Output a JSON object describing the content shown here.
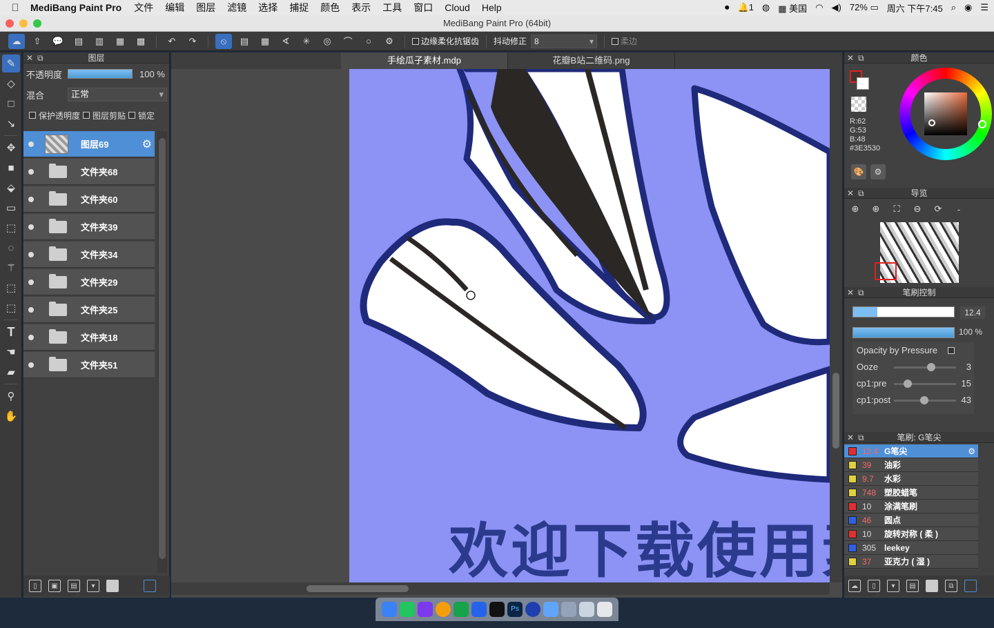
{
  "menubar": {
    "app_name": "MediBang Paint Pro",
    "menus": [
      "文件",
      "编辑",
      "图层",
      "滤镜",
      "选择",
      "捕捉",
      "颜色",
      "表示",
      "工具",
      "窗口",
      "Cloud",
      "Help"
    ],
    "status": {
      "notif_count": "1",
      "region": "美国",
      "battery": "72%",
      "clock": "周六 下午7:45"
    }
  },
  "window": {
    "title": "MediBang Paint Pro (64bit)"
  },
  "toolbar": {
    "antialias_label": "边缘柔化抗锯齿",
    "stabilizer_label": "抖动修正",
    "stabilizer_value": "8",
    "soft_label": "柔边"
  },
  "layers_panel": {
    "title": "图层",
    "opacity_label": "不透明度",
    "opacity_value": "100 %",
    "blend_label": "混合",
    "blend_value": "正常",
    "protect_alpha": "保护透明度",
    "clip": "图层剪贴",
    "lock": "锁定",
    "layers": [
      {
        "name": "图层69",
        "type": "layer",
        "selected": true
      },
      {
        "name": "文件夹68",
        "type": "folder"
      },
      {
        "name": "文件夹60",
        "type": "folder"
      },
      {
        "name": "文件夹39",
        "type": "folder"
      },
      {
        "name": "文件夹34",
        "type": "folder"
      },
      {
        "name": "文件夹29",
        "type": "folder"
      },
      {
        "name": "文件夹25",
        "type": "folder"
      },
      {
        "name": "文件夹18",
        "type": "folder"
      },
      {
        "name": "文件夹51",
        "type": "folder"
      }
    ]
  },
  "tabs": [
    {
      "label": "手绘瓜子素材.mdp",
      "active": true
    },
    {
      "label": "花瓣B站二维码.png",
      "active": false
    }
  ],
  "canvas": {
    "watermark_text": "欢迎下载使用素",
    "bg_color": "#8c93f4",
    "outline_color": "#1f2a7a",
    "stripe_color": "#2b2725"
  },
  "color_panel": {
    "title": "颜色",
    "r": "R:62",
    "g": "G:53",
    "b": "B:48",
    "hex": "#3E3530",
    "primary_color": "#3E3530",
    "fg_swatch": "#e02020"
  },
  "navigator": {
    "title": "导览"
  },
  "brush_control": {
    "title": "笔刷控制",
    "size_value": "12.4",
    "opacity_value": "100 %",
    "params": [
      {
        "label": "Opacity by Pressure",
        "value": ""
      },
      {
        "label": "Ooze",
        "value": "3"
      },
      {
        "label": "cp1:pre",
        "value": "15"
      },
      {
        "label": "cp1:post",
        "value": "43"
      }
    ]
  },
  "brush_list": {
    "title": "笔刷: G笔尖",
    "brushes": [
      {
        "size": "12.4",
        "name": "G笔尖",
        "color": "#e03030",
        "selected": true
      },
      {
        "size": "39",
        "name": "油彩",
        "color": "#e0d040"
      },
      {
        "size": "9.7",
        "name": "水彩",
        "color": "#e0d040"
      },
      {
        "size": "748",
        "name": "塑胶蜡笔",
        "color": "#e0d040"
      },
      {
        "size": "10",
        "name": "涂满笔刷",
        "color": "#e03030"
      },
      {
        "size": "46",
        "name": "圆点",
        "color": "#3060e0"
      },
      {
        "size": "10",
        "name": "旋转对称 ( 柔 )",
        "color": "#e03030"
      },
      {
        "size": "305",
        "name": "leekey",
        "color": "#3060e0"
      },
      {
        "size": "37",
        "name": "亚克力 ( 湿 )",
        "color": "#e0d040"
      }
    ]
  }
}
